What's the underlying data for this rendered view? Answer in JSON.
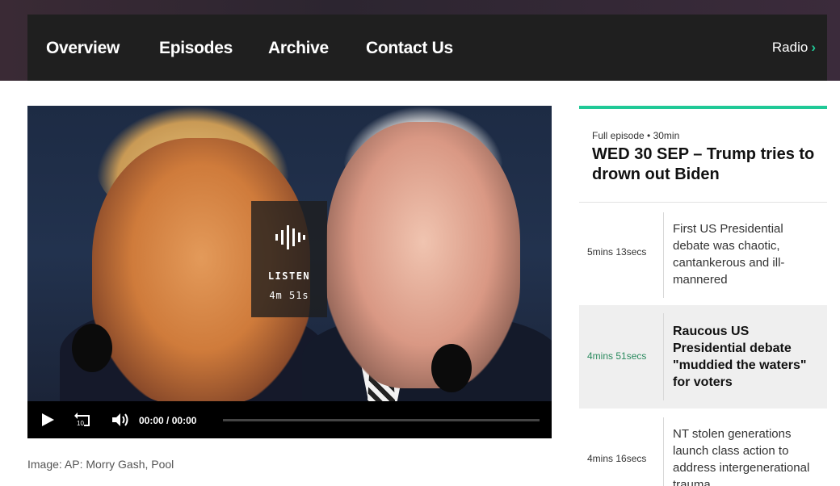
{
  "nav": {
    "items": [
      "Overview",
      "Episodes",
      "Archive",
      "Contact Us"
    ],
    "radio_label": "Radio",
    "radio_chevron": "›"
  },
  "player": {
    "listen_label": "LISTEN",
    "listen_duration": "4m 51s",
    "current_time": "00:00",
    "separator": "/",
    "total_time": "00:00",
    "replay_seconds": "10",
    "progress": 0
  },
  "caption": "Image: AP: Morry Gash, Pool",
  "episode": {
    "meta": "Full episode • 30min",
    "title": "WED 30 SEP – Trump tries to drown out Biden"
  },
  "segments": [
    {
      "duration": "5mins 13secs",
      "title": "First US Presidential debate was chaotic, cantankerous and ill-mannered",
      "active": false
    },
    {
      "duration": "4mins 51secs",
      "title": "Raucous US Presidential debate \"muddied the waters\" for voters",
      "active": true
    },
    {
      "duration": "4mins 16secs",
      "title": "NT stolen generations launch class action to address intergenerational trauma",
      "active": false
    }
  ],
  "colors": {
    "accent": "#20c997",
    "nav_bg": "#1f1f1f",
    "active_duration": "#2a8a5e"
  }
}
